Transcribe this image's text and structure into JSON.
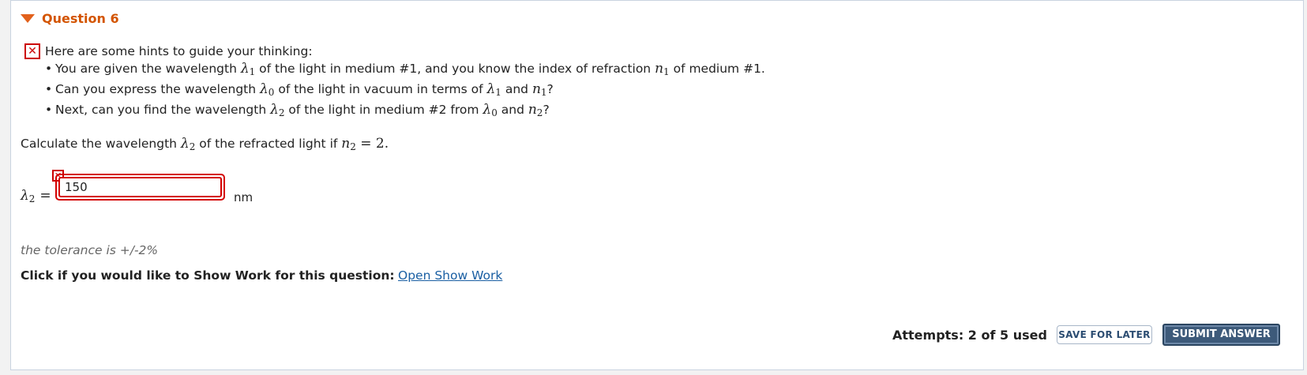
{
  "question": {
    "title": "Question 6"
  },
  "hints": {
    "intro": "Here are some hints to guide your thinking:",
    "items": [
      {
        "a": "You are given the wavelength ",
        "b": " of the light in medium #1, and you know the index of refraction ",
        "c": " of medium #1."
      },
      {
        "a": "Can you express the wavelength ",
        "b": " of the light in vacuum in terms of ",
        "c": " and ",
        "d": "?"
      },
      {
        "a": "Next, can you find the wavelength ",
        "b": " of the light in medium #2 from ",
        "c": " and ",
        "d": "?"
      }
    ]
  },
  "symbols": {
    "lambda": "λ",
    "n": "n",
    "sub1": "1",
    "sub0": "0",
    "sub2": "2"
  },
  "calc": {
    "a": "Calculate the wavelength ",
    "b": " of the refracted light if ",
    "eq": " = 2."
  },
  "answer": {
    "value": "150",
    "unit": "nm",
    "equals": "="
  },
  "tolerance": "the tolerance is +/-2%",
  "showwork": {
    "prompt": "Click if you would like to Show Work for this question:",
    "link": "Open Show Work"
  },
  "footer": {
    "attempts": "Attempts: 2 of 5 used",
    "save": "SAVE FOR LATER",
    "submit": "SUBMIT ANSWER"
  },
  "colors": {
    "accent": "#d35400",
    "error": "#cc0000",
    "link": "#1a5fa3",
    "submit_bg": "#3d5a7a"
  }
}
